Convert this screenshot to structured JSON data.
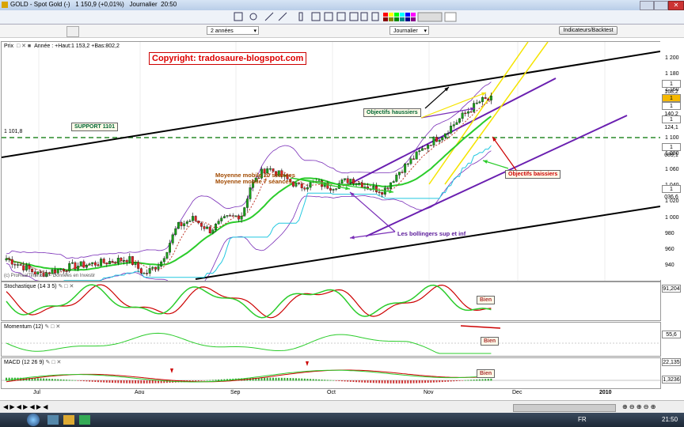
{
  "window": {
    "title": "GOLD - Spot Gold (-)",
    "quote": "1 150,9 (+0,01%)",
    "period": "Journalier",
    "time": "20:50"
  },
  "selectors": {
    "range": "2 années",
    "interval": "Journalier",
    "indicator_button": "Indicateurs/Backtest"
  },
  "price_panel": {
    "name": "Prix",
    "header": "Année : +Haut:1 153,2 +Bas:802,2",
    "copyright": "Copyright: tradosaure-blogspot.com",
    "support_label": "SUPPORT 1101",
    "support_value": "1 101,8",
    "watermark": "(c) ProRealTime.com - Données en Investir",
    "annotations": {
      "ma": "Moyenne mobile 20 séances",
      "ma7": "Moyenne mobile 7 séances",
      "bollinger": "Les bollingers sup et inf",
      "bull": "Objectifs haussiers",
      "bear": "Objectifs baissiers"
    },
    "axis_ticks": [
      "1 200",
      "1 180",
      "1 160",
      "1 140",
      "1 120",
      "1 100",
      "1 080",
      "1 060",
      "1 040",
      "1 020",
      "1 000",
      "980",
      "960",
      "940"
    ],
    "value_tags": [
      "1 168,2",
      "1 150,8",
      "1 140,2",
      "1 124,1",
      "1 089,1",
      "1 036,6"
    ]
  },
  "stoch_panel": {
    "name": "Stochastique (14 3 5)",
    "value": "91,204",
    "note": "Bien"
  },
  "momentum_panel": {
    "name": "Momentum (12)",
    "value": "55,6",
    "note": "Bien"
  },
  "macd_panel": {
    "name": "MACD (12 26 9)",
    "values": [
      "22,135",
      "1,3236"
    ],
    "note": "Bien"
  },
  "x_axis": {
    "labels": [
      "Jul",
      "Aou",
      "Sep",
      "Oct",
      "Nov",
      "Dec",
      "2010"
    ]
  },
  "taskbar": {
    "lang": "FR",
    "clock": "21:50"
  },
  "colors": {
    "up": "#1aa01a",
    "down": "#d22",
    "bollinger": "#7a2fb8",
    "trend": "#000",
    "yellow": "#f5e400",
    "support": "#2a8a2a"
  },
  "chart_data": {
    "type": "line",
    "title": "GOLD - Spot Gold (-)",
    "ylim": [
      930,
      1210
    ],
    "x": [
      "Jul",
      "Aou",
      "Sep",
      "Oct",
      "Nov",
      "Dec"
    ],
    "series": [
      {
        "name": "Moyenne mobile 20 séances",
        "values": [
          935,
          955,
          975,
          1015,
          1045,
          1120
        ]
      },
      {
        "name": "Moyenne mobile 7 séances",
        "values": [
          940,
          958,
          990,
          1030,
          1060,
          1140
        ]
      }
    ]
  }
}
